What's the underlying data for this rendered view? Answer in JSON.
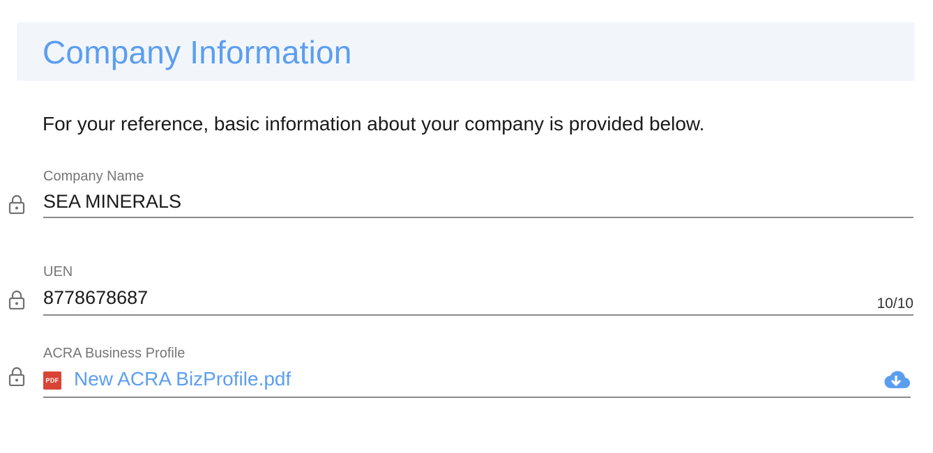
{
  "header": {
    "title": "Company Information"
  },
  "intro": "For your reference, basic information about your company is provided below.",
  "fields": [
    {
      "label": "Company Name",
      "value": "SEA MINERALS",
      "locked": true
    },
    {
      "label": "UEN",
      "value": "8778678687",
      "counter": "10/10",
      "locked": true
    },
    {
      "label": "ACRA Business Profile",
      "file_name": "New ACRA BizProfile.pdf",
      "file_badge": "PDF",
      "locked": true
    }
  ],
  "colors": {
    "accent": "#5b9ef0",
    "header_bg": "#f2f6fb",
    "pdf_badge": "#d94436"
  },
  "icons": {
    "lock": "lock-icon",
    "pdf": "pdf-file-icon",
    "download": "cloud-download-icon"
  }
}
